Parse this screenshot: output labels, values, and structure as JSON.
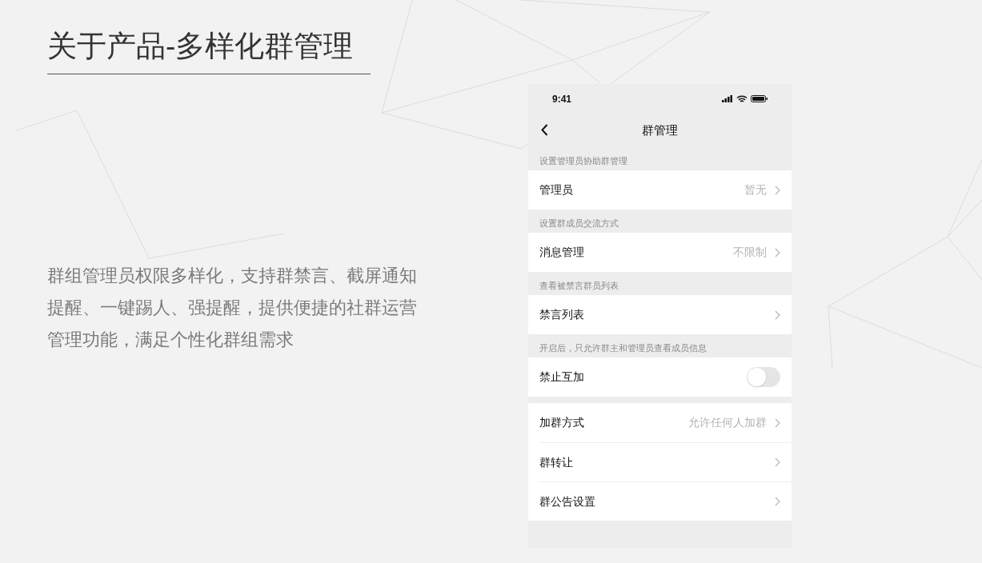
{
  "slide": {
    "title": "关于产品-多样化群管理",
    "description": "群组管理员权限多样化，支持群禁言、截屏通知提醒、一键踢人、强提醒，提供便捷的社群运营管理功能，满足个性化群组需求"
  },
  "phone": {
    "status_bar": {
      "time": "9:41"
    },
    "nav": {
      "title": "群管理"
    },
    "sections": [
      {
        "header": "设置管理员协助群管理",
        "rows": [
          {
            "kind": "link",
            "label": "管理员",
            "value": "暂无"
          }
        ]
      },
      {
        "header": "设置群成员交流方式",
        "rows": [
          {
            "kind": "link",
            "label": "消息管理",
            "value": "不限制"
          }
        ]
      },
      {
        "header": "查看被禁言群员列表",
        "rows": [
          {
            "kind": "link",
            "label": "禁言列表"
          }
        ]
      },
      {
        "header": "开启后，只允许群主和管理员查看成员信息",
        "rows": [
          {
            "kind": "toggle",
            "label": "禁止互加",
            "on": false
          }
        ]
      },
      {
        "rows": [
          {
            "kind": "link",
            "label": "加群方式",
            "value": "允许任何人加群"
          },
          {
            "kind": "link",
            "label": "群转让"
          },
          {
            "kind": "link",
            "label": "群公告设置"
          }
        ]
      }
    ]
  }
}
